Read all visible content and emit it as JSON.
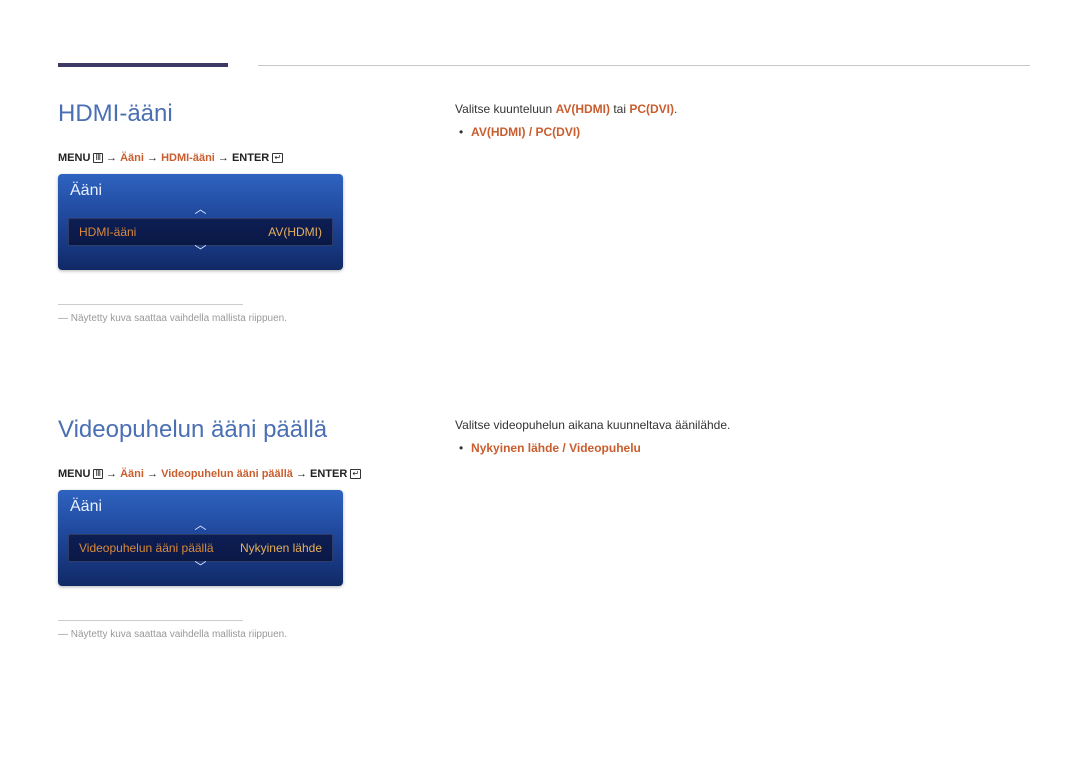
{
  "section1": {
    "title": "HDMI-ääni",
    "breadcrumb": {
      "menu": "MENU",
      "arrow": "→",
      "p1": "Ääni",
      "p2": "HDMI-ääni",
      "enter": "ENTER"
    },
    "osd": {
      "title": "Ääni",
      "row_label": "HDMI-ääni",
      "row_value": "AV(HDMI)"
    },
    "footnote": "―  Näytetty kuva saattaa vaihdella mallista riippuen.",
    "desc_prefix": "Valitse kuunteluun ",
    "desc_opt1": "AV(HDMI)",
    "desc_mid": " tai ",
    "desc_opt2": "PC(DVI)",
    "desc_suffix": ".",
    "bullet": "AV(HDMI) / PC(DVI)"
  },
  "section2": {
    "title": "Videopuhelun ääni päällä",
    "breadcrumb": {
      "menu": "MENU",
      "arrow": "→",
      "p1": "Ääni",
      "p2": "Videopuhelun ääni päällä",
      "enter": "ENTER"
    },
    "osd": {
      "title": "Ääni",
      "row_label": "Videopuhelun ääni päällä",
      "row_value": "Nykyinen lähde"
    },
    "footnote": "―  Näytetty kuva saattaa vaihdella mallista riippuen.",
    "desc": "Valitse videopuhelun aikana kuunneltava äänilähde.",
    "bullet": "Nykyinen lähde / Videopuhelu"
  }
}
